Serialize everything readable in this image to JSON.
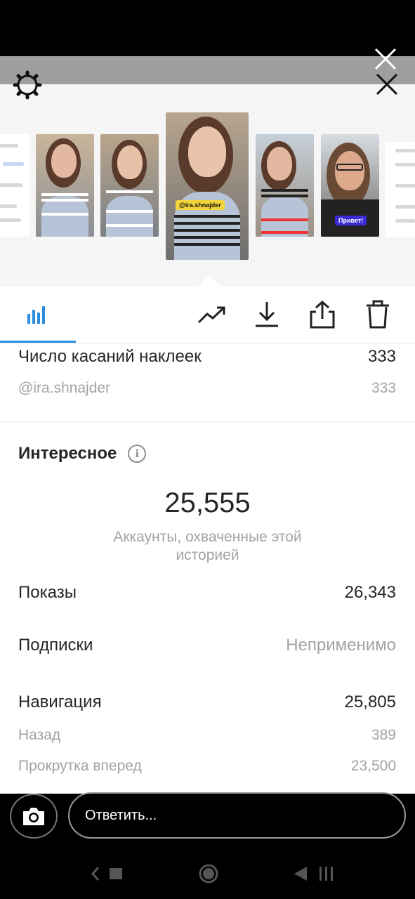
{
  "viewer": {
    "thumbnails": [
      {
        "type": "chat"
      },
      {
        "type": "selfie"
      },
      {
        "type": "selfie"
      },
      {
        "type": "selfie",
        "selected": true,
        "tag": "@ira.shnajder"
      },
      {
        "type": "selfie"
      },
      {
        "type": "selfie-glasses",
        "tag": "Привет!"
      },
      {
        "type": "chat"
      }
    ]
  },
  "toolbar": {
    "icons": [
      "insights-bar-icon",
      "trending-up-icon",
      "download-icon",
      "share-icon",
      "trash-icon"
    ]
  },
  "stats": {
    "sticker_taps_label": "Число касаний наклеек",
    "sticker_taps_value": "333",
    "mention_label": "@ira.shnajder",
    "mention_value": "333",
    "discovery_title": "Интересное",
    "reach_value": "25,555",
    "reach_label": "Аккаунты, охваченные этой историей",
    "impressions_label": "Показы",
    "impressions_value": "26,343",
    "follows_label": "Подписки",
    "follows_value": "Неприменимо",
    "navigation_label": "Навигация",
    "navigation_value": "25,805",
    "back_label": "Назад",
    "back_value": "389",
    "forward_label": "Прокрутка вперед",
    "forward_value": "23,500"
  },
  "reply": {
    "placeholder": "Ответить..."
  },
  "colors": {
    "accent": "#2a8de0",
    "text_primary": "#262626",
    "text_secondary": "#a3a3a3"
  }
}
